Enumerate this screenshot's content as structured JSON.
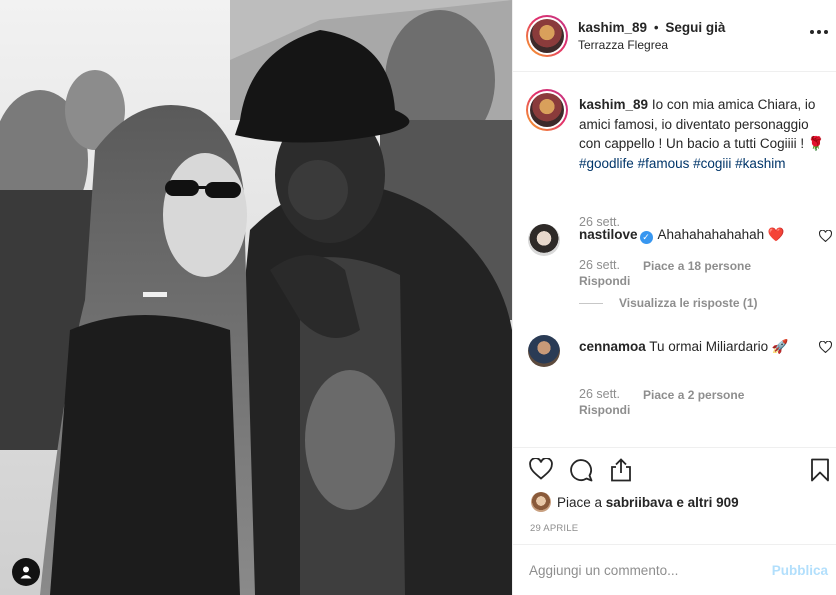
{
  "post": {
    "author": "kashim_89",
    "follow_status": "Segui già",
    "separator": "•",
    "location": "Terrazza Flegrea"
  },
  "caption": {
    "username": "kashim_89",
    "text": "Io con mia amica Chiara, io amici famosi, io diventato personaggio con cappello ! Un bacio a tutti Cogiiii ! 🌹",
    "hashtags": [
      "#goodlife",
      "#famous",
      "#cogiii",
      "#kashim"
    ],
    "date": "26 sett."
  },
  "comments": [
    {
      "username": "nastilove",
      "verified": true,
      "text": "Ahahahahahahah ❤️",
      "date": "26 sett.",
      "likes": "Piace a 18 persone",
      "reply": "Rispondi",
      "view_replies": "Visualizza le risposte (1)"
    },
    {
      "username": "cennamoa",
      "verified": false,
      "text": "Tu ormai Miliardario 🚀",
      "date": "26 sett.",
      "likes": "Piace a 2 persone",
      "reply": "Rispondi"
    }
  ],
  "likes_summary": {
    "prefix": "Piace a",
    "user": "sabriibava",
    "suffix": "e altri 909"
  },
  "post_date": "29 APRILE",
  "add_comment": {
    "placeholder": "Aggiungi un commento...",
    "submit": "Pubblica"
  },
  "colors": {
    "text": "#262626",
    "muted": "#8e8e8e",
    "hashtag": "#003569",
    "publish_disabled": "#b2dffc",
    "verified": "#3897f0",
    "border": "#efefef"
  },
  "icons": [
    "user-tag-icon",
    "more-options-icon",
    "verified-badge-icon",
    "heart-icon",
    "comment-icon",
    "share-icon",
    "bookmark-icon"
  ]
}
